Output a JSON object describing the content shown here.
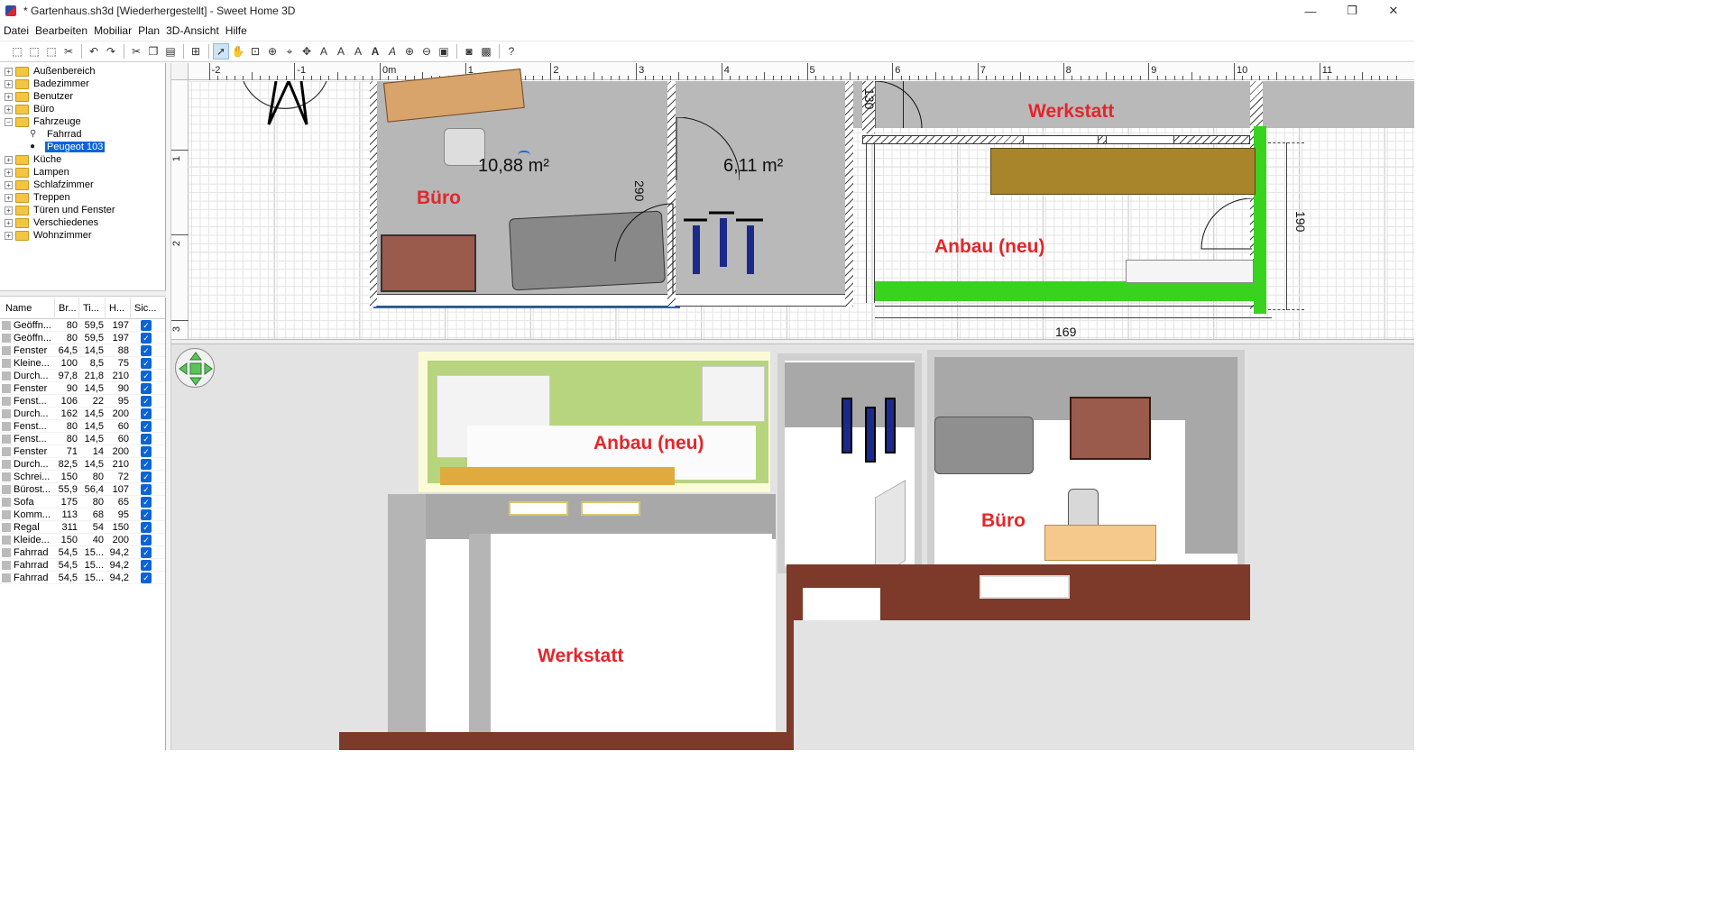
{
  "window": {
    "title": "* Gartenhaus.sh3d [Wiederhergestellt] - Sweet Home 3D",
    "controls": [
      "—",
      "❐",
      "✕"
    ]
  },
  "menu": [
    "Datei",
    "Bearbeiten",
    "Mobiliar",
    "Plan",
    "3D-Ansicht",
    "Hilfe"
  ],
  "toolbar": {
    "icons": [
      "new-home-icon",
      "open-icon",
      "save-icon",
      "cut-icon",
      "undo-icon",
      "redo-icon",
      "cut2-icon",
      "copy-icon",
      "paste-icon",
      "add-furniture-icon",
      "select-icon",
      "pan-icon",
      "create-walls-icon",
      "create-rooms-icon",
      "create-polylines-icon",
      "create-dimensions-icon",
      "create-labels-icon",
      "increase-text-icon",
      "decrease-text-icon",
      "bold-icon",
      "italic-icon",
      "zoom-in-icon",
      "zoom-out-icon",
      "create-photo-icon",
      "create-video-icon",
      "aerial-view-icon",
      "help-icon"
    ],
    "selected": "select-icon"
  },
  "catalog": {
    "categories": [
      {
        "label": "Außenbereich",
        "expanded": false
      },
      {
        "label": "Badezimmer",
        "expanded": false
      },
      {
        "label": "Benutzer",
        "expanded": false
      },
      {
        "label": "Büro",
        "expanded": false
      },
      {
        "label": "Fahrzeuge",
        "expanded": true,
        "children": [
          {
            "label": "Fahrrad",
            "selected": false
          },
          {
            "label": "Peugeot 103",
            "selected": true
          }
        ]
      },
      {
        "label": "Küche",
        "expanded": false
      },
      {
        "label": "Lampen",
        "expanded": false
      },
      {
        "label": "Schlafzimmer",
        "expanded": false
      },
      {
        "label": "Treppen",
        "expanded": false
      },
      {
        "label": "Türen und Fenster",
        "expanded": false
      },
      {
        "label": "Verschiedenes",
        "expanded": false
      },
      {
        "label": "Wohnzimmer",
        "expanded": false
      }
    ]
  },
  "furniture": {
    "columns": [
      "Name",
      "Br...",
      "Ti...",
      "H...",
      "Sic..."
    ],
    "rows": [
      {
        "name": "Geöffn...",
        "w": "80",
        "d": "59,5",
        "h": "197",
        "visible": true
      },
      {
        "name": "Geöffn...",
        "w": "80",
        "d": "59,5",
        "h": "197",
        "visible": true
      },
      {
        "name": "Fenster",
        "w": "64,5",
        "d": "14,5",
        "h": "88",
        "visible": true
      },
      {
        "name": "Kleine...",
        "w": "100",
        "d": "8,5",
        "h": "75",
        "visible": true
      },
      {
        "name": "Durch...",
        "w": "97,8",
        "d": "21,8",
        "h": "210",
        "visible": true
      },
      {
        "name": "Fenster",
        "w": "90",
        "d": "14,5",
        "h": "90",
        "visible": true
      },
      {
        "name": "Fenst...",
        "w": "106",
        "d": "22",
        "h": "95",
        "visible": true
      },
      {
        "name": "Durch...",
        "w": "162",
        "d": "14,5",
        "h": "200",
        "visible": true
      },
      {
        "name": "Fenst...",
        "w": "80",
        "d": "14,5",
        "h": "60",
        "visible": true
      },
      {
        "name": "Fenst...",
        "w": "80",
        "d": "14,5",
        "h": "60",
        "visible": true
      },
      {
        "name": "Fenster",
        "w": "71",
        "d": "14",
        "h": "200",
        "visible": true
      },
      {
        "name": "Durch...",
        "w": "82,5",
        "d": "14,5",
        "h": "210",
        "visible": true
      },
      {
        "name": "Schrei...",
        "w": "150",
        "d": "80",
        "h": "72",
        "visible": true
      },
      {
        "name": "Bürost...",
        "w": "55,9",
        "d": "56,4",
        "h": "107",
        "visible": true
      },
      {
        "name": "Sofa",
        "w": "175",
        "d": "80",
        "h": "65",
        "visible": true
      },
      {
        "name": "Komm...",
        "w": "113",
        "d": "68",
        "h": "95",
        "visible": true
      },
      {
        "name": "Regal",
        "w": "311",
        "d": "54",
        "h": "150",
        "visible": true
      },
      {
        "name": "Kleide...",
        "w": "150",
        "d": "40",
        "h": "200",
        "visible": true
      },
      {
        "name": "Fahrrad",
        "w": "54,5",
        "d": "15...",
        "h": "94,2",
        "visible": true
      },
      {
        "name": "Fahrrad",
        "w": "54,5",
        "d": "15...",
        "h": "94,2",
        "visible": true
      },
      {
        "name": "Fahrrad",
        "w": "54,5",
        "d": "15...",
        "h": "94,2",
        "visible": true
      }
    ]
  },
  "plan": {
    "ruler_top": [
      "-2",
      "-1",
      "0m",
      "1",
      "2",
      "3",
      "4",
      "5",
      "6",
      "7",
      "8",
      "9",
      "10",
      "11"
    ],
    "ruler_left": [
      "1",
      "2",
      "3"
    ],
    "rooms": {
      "buero": "Büro",
      "werkstatt": "Werkstatt",
      "anbau": "Anbau (neu)"
    },
    "areas": {
      "buero": "10,88 m²",
      "flur": "6,11 m²"
    },
    "dimensions": {
      "d290": "290",
      "d130": "130",
      "d190": "190",
      "d_bottom": "169"
    }
  },
  "view3d": {
    "rooms": {
      "anbau": "Anbau (neu)",
      "buero": "Büro",
      "werkstatt": "Werkstatt"
    }
  },
  "colors": {
    "room_label": "#e4262a",
    "selection": "#0a64d8",
    "anbau_wall": "#38d21f"
  }
}
